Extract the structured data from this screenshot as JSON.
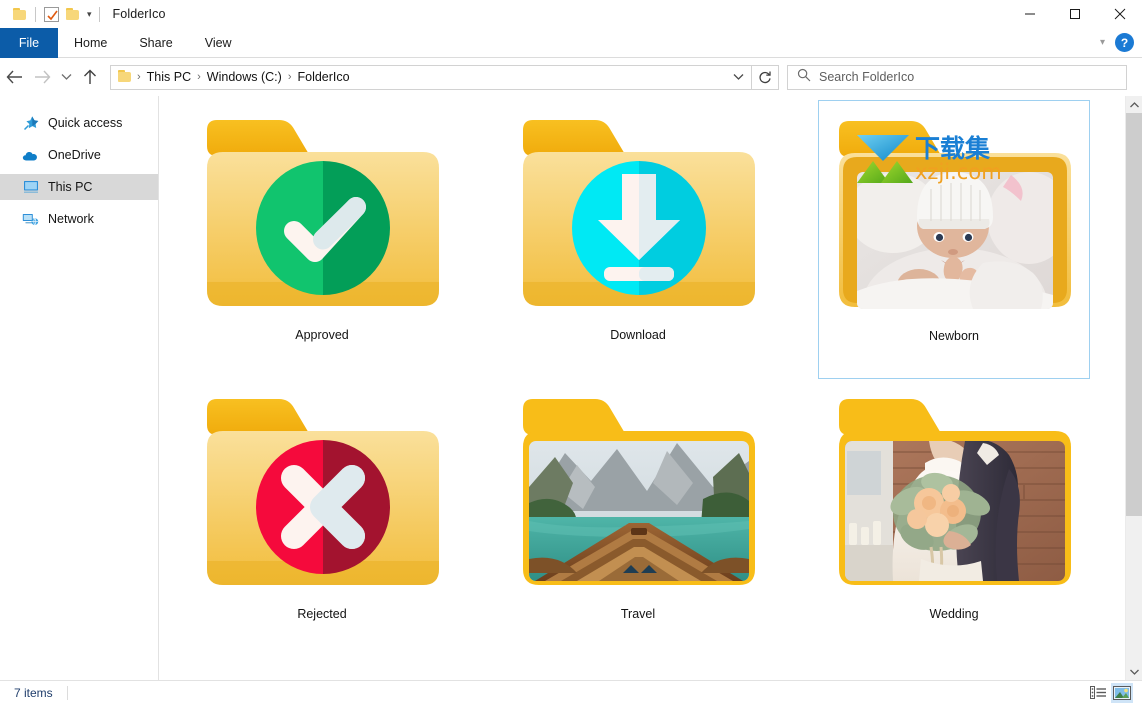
{
  "window": {
    "title": "FolderIco",
    "quick_access_icons": [
      "folder-icon",
      "checkbox-icon",
      "folder-icon",
      "dropdown-caret-icon"
    ],
    "controls": {
      "minimize": "minimize-icon",
      "maximize": "maximize-icon",
      "close": "close-icon"
    }
  },
  "ribbon": {
    "tabs": [
      "File",
      "Home",
      "Share",
      "View"
    ],
    "collapse_icon": "chevron-down-icon",
    "help_label": "?"
  },
  "address": {
    "back_icon": "back-arrow-icon",
    "forward_icon": "forward-arrow-icon",
    "recent_icon": "chevron-down-icon",
    "up_icon": "up-arrow-icon",
    "crumbs": [
      "This PC",
      "Windows (C:)",
      "FolderIco"
    ],
    "separator": "›",
    "dropdown_icon": "chevron-down-icon",
    "refresh_icon": "refresh-icon"
  },
  "search": {
    "icon": "search-icon",
    "placeholder": "Search FolderIco"
  },
  "sidebar": {
    "items": [
      {
        "label": "Quick access",
        "icon": "pin-star-icon",
        "selected": false
      },
      {
        "label": "OneDrive",
        "icon": "cloud-icon",
        "selected": false
      },
      {
        "label": "This PC",
        "icon": "monitor-icon",
        "selected": true
      },
      {
        "label": "Network",
        "icon": "network-icon",
        "selected": false
      }
    ]
  },
  "files": [
    {
      "name": "Approved",
      "type": "folder-badge",
      "badge": "check-mark",
      "badge_color": "#0fbf6a",
      "badge_color_dark": "#07a256",
      "selected": false
    },
    {
      "name": "Download",
      "type": "folder-badge",
      "badge": "download-arrow",
      "badge_color": "#00e5f0",
      "badge_color_dark": "#00c6d6",
      "selected": false
    },
    {
      "name": "Newborn",
      "type": "folder-photo",
      "photo": "baby-in-white-knit-hat",
      "selected": true
    },
    {
      "name": "Rejected",
      "type": "folder-badge",
      "badge": "cross-mark",
      "badge_color": "#f4093c",
      "badge_color_dark": "#a81232",
      "selected": false
    },
    {
      "name": "Travel",
      "type": "folder-photo",
      "photo": "boat-bow-on-alpine-lake",
      "selected": false
    },
    {
      "name": "Wedding",
      "type": "folder-photo",
      "photo": "bride-with-bouquet-and-groom",
      "selected": false
    }
  ],
  "watermark": {
    "text_cn": "下载集",
    "text_url": "xzji.com",
    "cn_color": "#1a7fd4",
    "url_color": "#f0a020",
    "arrow_color": "#2aaee6",
    "mountain_color": "#7cbf2a"
  },
  "status": {
    "items_text": "7 items",
    "view_buttons": [
      {
        "icon": "details-view-icon",
        "active": false
      },
      {
        "icon": "large-icons-view-icon",
        "active": true
      }
    ]
  },
  "scrollbar": {
    "up_icon": "chevron-up-icon",
    "down_icon": "chevron-down-icon"
  },
  "colors": {
    "accent": "#0c5ca8",
    "selection_border": "#9ed0f0",
    "sidebar_selected": "#d8d8d8",
    "folder_tab": "#f5b616",
    "folder_body": "#f8d98a",
    "folder_edge": "#e3a61a"
  }
}
